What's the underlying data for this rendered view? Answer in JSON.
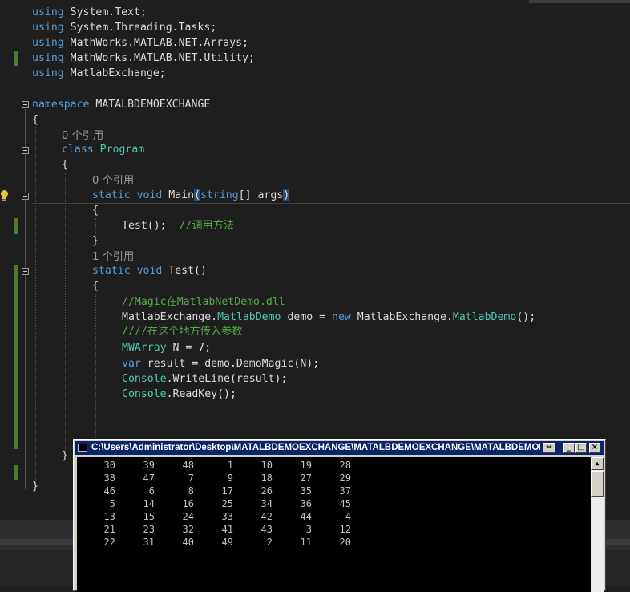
{
  "editor": {
    "code_lines": [
      {
        "kw": "using",
        "rest": " System.Text;"
      },
      {
        "kw": "using",
        "rest": " System.Threading.Tasks;"
      },
      {
        "kw": "using",
        "rest": " MathWorks.MATLAB.NET.Arrays;"
      },
      {
        "kw": "using",
        "rest": " MathWorks.MATLAB.NET.Utility;"
      },
      {
        "kw": "using",
        "rest": " MatlabExchange;"
      }
    ],
    "namespace_kw": "namespace",
    "namespace_name": " MATALBDEMOEXCHANGE",
    "brace_open": "{",
    "brace_close": "}",
    "ref0_a": "0 个引用",
    "class_kw": "class",
    "class_name": "Program",
    "ref0_b": "0 个引用",
    "main_static": "static",
    "main_void": "void",
    "main_name": " Main",
    "main_paren_open": "(",
    "main_string": "string",
    "main_args": "[] args",
    "main_paren_close": ")",
    "test_call": "Test();",
    "test_call_comment": "//调用方法",
    "ref1": "1 个引用",
    "test_static": "static",
    "test_void": "void",
    "test_sig": " Test()",
    "comment_magic": "//Magic在MatlabNetDemo.dll",
    "demo_ns": "MatlabExchange.",
    "demo_type": "MatlabDemo",
    "demo_var": " demo = ",
    "demo_new": "new",
    "demo_ns2": " MatlabExchange.",
    "demo_type2": "MatlabDemo",
    "demo_end": "();",
    "comment_param": "////在这个地方传入参数",
    "mw_type": "MWArray",
    "mw_rest": " N = 7;",
    "var_kw": "var",
    "var_rest": " result = demo.DemoMagic(N);",
    "console_type": "Console",
    "writeline_rest": ".WriteLine(result);",
    "console_type2": "Console",
    "readkey_rest": ".ReadKey();"
  },
  "console": {
    "title": "C:\\Users\\Administrator\\Desktop\\MATALBDEMOEXCHANGE\\MATALBDEMOEXCHANGE\\MATALBDEMOE",
    "resize_icon": "↔",
    "min_label": "_",
    "max_label": "□",
    "close_label": "×",
    "scroll_up": "▲",
    "rows": [
      [
        "30",
        "39",
        "48",
        "1",
        "10",
        "19",
        "28"
      ],
      [
        "38",
        "47",
        "7",
        "9",
        "18",
        "27",
        "29"
      ],
      [
        "46",
        "6",
        "8",
        "17",
        "26",
        "35",
        "37"
      ],
      [
        "5",
        "14",
        "16",
        "25",
        "34",
        "36",
        "45"
      ],
      [
        "13",
        "15",
        "24",
        "33",
        "42",
        "44",
        "4"
      ],
      [
        "21",
        "23",
        "32",
        "41",
        "43",
        "3",
        "12"
      ],
      [
        "22",
        "31",
        "40",
        "49",
        "2",
        "11",
        "20"
      ]
    ]
  },
  "colors": {
    "keyword": "#569cd6",
    "type": "#4ec9b0",
    "comment": "#57a64a",
    "console_title_bg": "#0a246a"
  }
}
